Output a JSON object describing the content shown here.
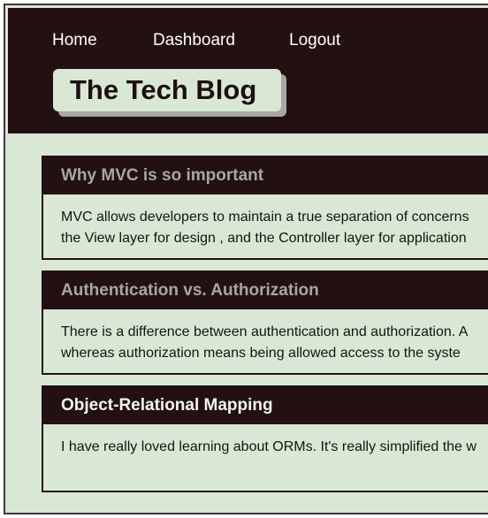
{
  "nav": {
    "home": "Home",
    "dashboard": "Dashboard",
    "logout": "Logout"
  },
  "site": {
    "title": "The Tech Blog"
  },
  "posts": [
    {
      "title": "Why MVC is so important",
      "body": [
        "MVC allows developers to maintain a true separation of concerns",
        "the View layer for design , and the Controller layer for application"
      ]
    },
    {
      "title": "Authentication vs. Authorization",
      "body": [
        "There is a difference between authentication and authorization. A",
        "whereas authorization means being allowed access to the syste"
      ]
    },
    {
      "title": "Object-Relational Mapping",
      "body": [
        "I have really loved learning about ORMs. It's really simplified the w"
      ]
    }
  ],
  "colors": {
    "header_bg": "#231112",
    "page_bg": "#d9e8d4",
    "muted_title": "#a6a6a6",
    "bright_title": "#f4f4f4"
  }
}
